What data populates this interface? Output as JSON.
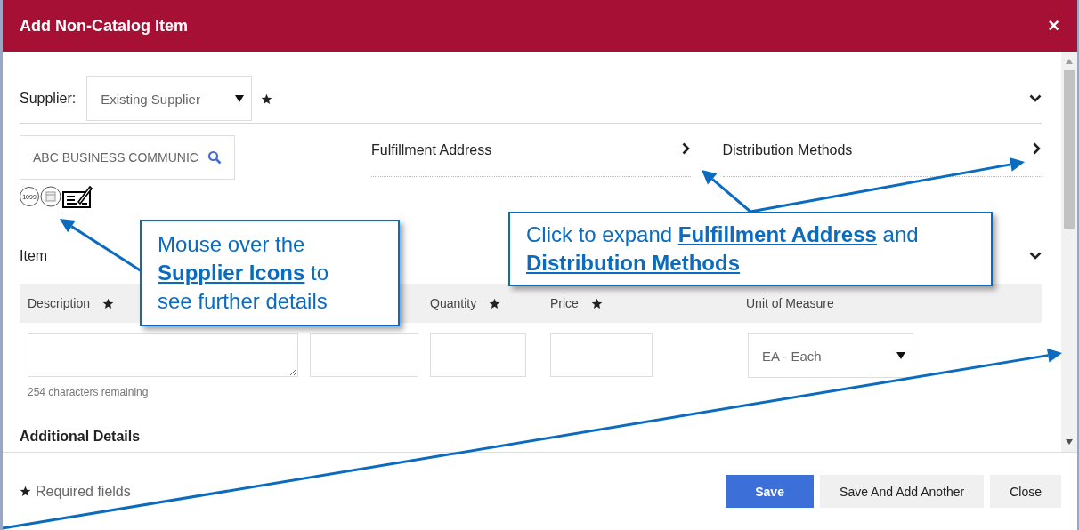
{
  "window": {
    "title": "Add Non-Catalog Item",
    "close": "×"
  },
  "supplier": {
    "label": "Supplier:",
    "type_value": "Existing Supplier",
    "required": true,
    "expanded": true,
    "search_value": "ABC BUSINESS COMMUNIC",
    "tax_badge": "1099"
  },
  "sections": [
    {
      "label": "Fulfillment Address",
      "expanded": false
    },
    {
      "label": "Distribution Methods",
      "expanded": false
    }
  ],
  "item": {
    "title": "Item",
    "expanded": true,
    "columns": [
      {
        "label": "Description",
        "required": true
      },
      {},
      {
        "label": "Quantity",
        "required": true
      },
      {
        "label": "Price",
        "required": true
      },
      {
        "label": "Unit of Measure",
        "required": false
      }
    ],
    "fields": [
      {
        "kind": "textarea",
        "hint": "254 characters remaining"
      },
      {
        "kind": "text"
      },
      {
        "kind": "text"
      },
      {
        "kind": "text"
      },
      {
        "kind": "select",
        "value": "EA - Each"
      }
    ]
  },
  "next_section": "Additional Details",
  "footer": {
    "legend": "Required fields",
    "buttons": [
      {
        "label": "Save",
        "kind": "primary"
      },
      {
        "label": "Save And Add Another",
        "kind": "secondary"
      },
      {
        "label": "Close",
        "kind": "secondary"
      }
    ]
  },
  "callouts": [
    {
      "text": "Mouse over the **Supplier Icons** to see further details"
    },
    {
      "text": "Click to expand **Fulfillment Address** and **Distribution Methods**"
    }
  ]
}
